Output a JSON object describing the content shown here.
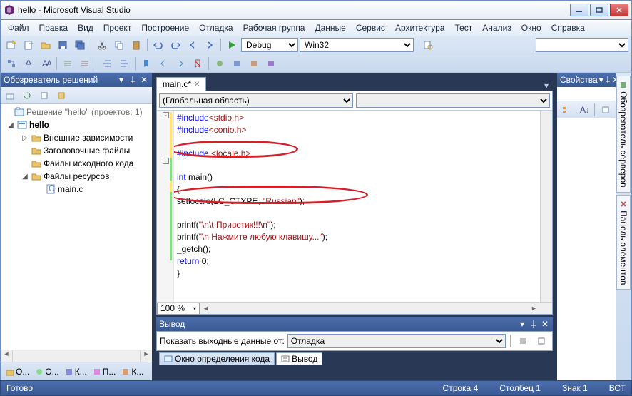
{
  "titlebar": {
    "title": "hello - Microsoft Visual Studio"
  },
  "menu": [
    "Файл",
    "Правка",
    "Вид",
    "Проект",
    "Построение",
    "Отладка",
    "Рабочая группа",
    "Данные",
    "Сервис",
    "Архитектура",
    "Тест",
    "Анализ",
    "Окно",
    "Справка"
  ],
  "toolbar": {
    "config": "Debug",
    "platform": "Win32"
  },
  "solution_explorer": {
    "title": "Обозреватель решений",
    "root": "Решение \"hello\" (проектов: 1)",
    "project": "hello",
    "folders": [
      "Внешние зависимости",
      "Заголовочные файлы",
      "Файлы исходного кода",
      "Файлы ресурсов"
    ],
    "file": "main.c",
    "bottom_tabs": [
      "О...",
      "О...",
      "К...",
      "П...",
      "К..."
    ]
  },
  "editor": {
    "tab_name": "main.c*",
    "scope": "(Глобальная область)",
    "scope2": "",
    "zoom": "100 %",
    "code": {
      "l1a": "#include",
      "l1b": "<stdio.h>",
      "l2a": "#include",
      "l2b": "<conio.h>",
      "l3a": "#include ",
      "l3b": "<locale.h>",
      "l5a": "int",
      "l5b": " main()",
      "l6": "{",
      "l7a": "setlocale(LC_CTYPE, ",
      "l7b": "\"Russian\"",
      "l7c": ");",
      "l9a": "printf(",
      "l9b": "\"\\n\\t Приветик!!!\\n\"",
      "l9c": ");",
      "l10a": "printf(",
      "l10b": "\"\\n Нажмите любую клавишу...\"",
      "l10c": ");",
      "l11": "_getch();",
      "l12a": "return",
      "l12b": " 0;",
      "l13": "}"
    }
  },
  "output": {
    "title": "Вывод",
    "show_label": "Показать выходные данные от:",
    "source": "Отладка",
    "tabs": [
      "Окно определения кода",
      "Вывод"
    ]
  },
  "properties": {
    "title": "Свойства"
  },
  "side_tabs": [
    "Обозреватель серверов",
    "Панель элементов"
  ],
  "status": {
    "ready": "Готово",
    "line": "Строка 4",
    "col": "Столбец 1",
    "ch": "Знак 1",
    "ins": "ВСТ"
  }
}
